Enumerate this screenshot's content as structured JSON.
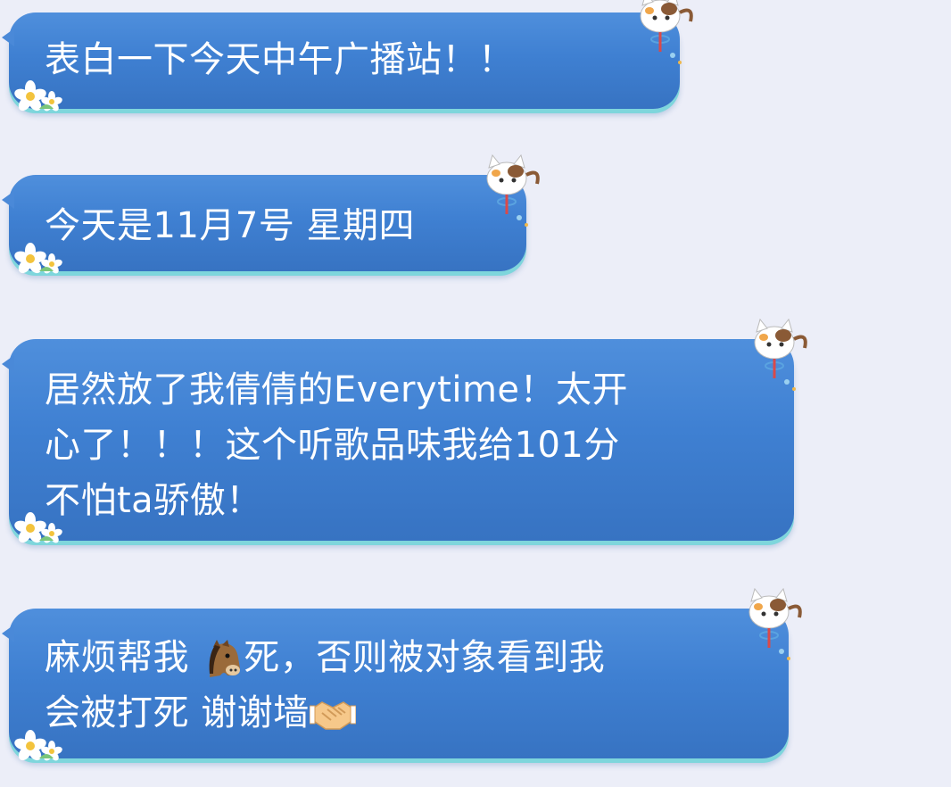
{
  "messages": [
    {
      "text": "表白一下今天中午广播站！！"
    },
    {
      "text": "今天是11月7号 星期四"
    },
    {
      "text": "居然放了我倩倩的Everytime！太开\n心了！！！这个听歌品味我给101分\n不怕ta骄傲！"
    },
    {
      "text_part1": "麻烦帮我",
      "text_part2": "死，否则被对象看到我\n会被打死 谢谢墙"
    }
  ],
  "icons": {
    "horse": "horse-face-emoji",
    "handshake": "handshake-emoji",
    "decor_flower": "flower-icon",
    "decor_cat": "cat-icon"
  },
  "colors": {
    "page_bg": "#eceef8",
    "bubble": "#4285d6",
    "bubble_edge": "#7ed6dc",
    "text": "#ffffff"
  }
}
